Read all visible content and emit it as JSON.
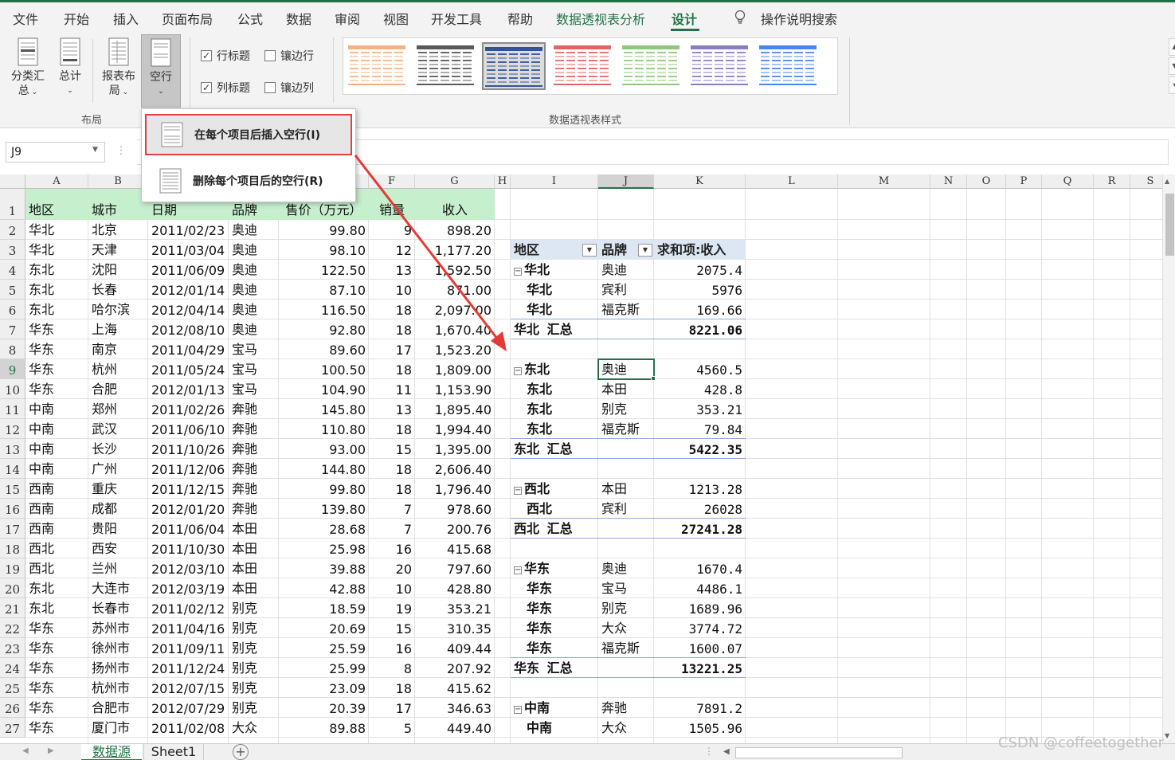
{
  "tabs": [
    "文件",
    "开始",
    "插入",
    "页面布局",
    "公式",
    "数据",
    "审阅",
    "视图",
    "开发工具",
    "帮助",
    "数据透视表分析",
    "设计"
  ],
  "tell_me": "操作说明搜索",
  "ribbon": {
    "subtotals": [
      "分类汇",
      "总"
    ],
    "grand_totals": "总计",
    "report_layout": [
      "报表布",
      "局"
    ],
    "blank_rows": "空行",
    "row_headers": "行标题",
    "banded_rows": "镶边行",
    "col_headers": "列标题",
    "banded_cols": "镶边列",
    "layout_group": "布局",
    "styles_group": "数据透视表样式"
  },
  "checks": {
    "row_headers": true,
    "banded_rows": false,
    "col_headers": true,
    "banded_cols": false
  },
  "style_colors": [
    "#f4b183",
    "#595959",
    "#2f5597",
    "#e06666",
    "#93c47d",
    "#8e7cc3",
    "#4a86e8"
  ],
  "dropdown": {
    "insert": "在每个项目后插入空行(I)",
    "remove": "删除每个项目后的空行(R)"
  },
  "name_box": "J9",
  "columns": [
    "A",
    "B",
    "C",
    "D",
    "E",
    "F",
    "G",
    "H",
    "I",
    "J",
    "K",
    "L",
    "M",
    "N",
    "O",
    "P",
    "Q",
    "R",
    "S"
  ],
  "source_header": [
    "地区",
    "城市",
    "日期",
    "品牌",
    "售价（万元）",
    "销量",
    "收入"
  ],
  "source_rows": [
    [
      "华北",
      "北京",
      "2011/02/23",
      "奥迪",
      "99.80",
      "9",
      "898.20"
    ],
    [
      "华北",
      "天津",
      "2011/03/04",
      "奥迪",
      "98.10",
      "12",
      "1,177.20"
    ],
    [
      "东北",
      "沈阳",
      "2011/06/09",
      "奥迪",
      "122.50",
      "13",
      "1,592.50"
    ],
    [
      "东北",
      "长春",
      "2012/01/14",
      "奥迪",
      "87.10",
      "10",
      "871.00"
    ],
    [
      "东北",
      "哈尔滨",
      "2012/04/14",
      "奥迪",
      "116.50",
      "18",
      "2,097.00"
    ],
    [
      "华东",
      "上海",
      "2012/08/10",
      "奥迪",
      "92.80",
      "18",
      "1,670.40"
    ],
    [
      "华东",
      "南京",
      "2011/04/29",
      "宝马",
      "89.60",
      "17",
      "1,523.20"
    ],
    [
      "华东",
      "杭州",
      "2011/05/24",
      "宝马",
      "100.50",
      "18",
      "1,809.00"
    ],
    [
      "华东",
      "合肥",
      "2012/01/13",
      "宝马",
      "104.90",
      "11",
      "1,153.90"
    ],
    [
      "中南",
      "郑州",
      "2011/02/26",
      "奔驰",
      "145.80",
      "13",
      "1,895.40"
    ],
    [
      "中南",
      "武汉",
      "2011/06/10",
      "奔驰",
      "110.80",
      "18",
      "1,994.40"
    ],
    [
      "中南",
      "长沙",
      "2011/10/26",
      "奔驰",
      "93.00",
      "15",
      "1,395.00"
    ],
    [
      "中南",
      "广州",
      "2011/12/06",
      "奔驰",
      "144.80",
      "18",
      "2,606.40"
    ],
    [
      "西南",
      "重庆",
      "2011/12/15",
      "奔驰",
      "99.80",
      "18",
      "1,796.40"
    ],
    [
      "西南",
      "成都",
      "2012/01/20",
      "奔驰",
      "139.80",
      "7",
      "978.60"
    ],
    [
      "西南",
      "贵阳",
      "2011/06/04",
      "本田",
      "28.68",
      "7",
      "200.76"
    ],
    [
      "西北",
      "西安",
      "2011/10/30",
      "本田",
      "25.98",
      "16",
      "415.68"
    ],
    [
      "西北",
      "兰州",
      "2012/03/10",
      "本田",
      "39.88",
      "20",
      "797.60"
    ],
    [
      "东北",
      "大连市",
      "2012/03/19",
      "本田",
      "42.88",
      "10",
      "428.80"
    ],
    [
      "东北",
      "长春市",
      "2011/02/12",
      "别克",
      "18.59",
      "19",
      "353.21"
    ],
    [
      "华东",
      "苏州市",
      "2011/04/16",
      "别克",
      "20.69",
      "15",
      "310.35"
    ],
    [
      "华东",
      "徐州市",
      "2011/09/11",
      "别克",
      "25.59",
      "16",
      "409.44"
    ],
    [
      "华东",
      "扬州市",
      "2011/12/24",
      "别克",
      "25.99",
      "8",
      "207.92"
    ],
    [
      "华东",
      "杭州市",
      "2012/07/15",
      "别克",
      "23.09",
      "18",
      "415.62"
    ],
    [
      "华东",
      "合肥市",
      "2012/07/29",
      "别克",
      "20.39",
      "17",
      "346.63"
    ],
    [
      "华东",
      "厦门市",
      "2011/02/08",
      "大众",
      "89.88",
      "5",
      "449.40"
    ]
  ],
  "pivot": {
    "headers": [
      "地区",
      "品牌",
      "求和项:收入"
    ],
    "rows": [
      {
        "region": "华北",
        "brand": "奥迪",
        "value": "2075.4",
        "first": true
      },
      {
        "region": "华北",
        "brand": "宾利",
        "value": "5976"
      },
      {
        "region": "华北",
        "brand": "福克斯",
        "value": "169.66"
      },
      {
        "total": "华北 汇总",
        "value": "8221.06"
      },
      {
        "blank": true
      },
      {
        "region": "东北",
        "brand": "奥迪",
        "value": "4560.5",
        "first": true
      },
      {
        "region": "东北",
        "brand": "本田",
        "value": "428.8"
      },
      {
        "region": "东北",
        "brand": "别克",
        "value": "353.21"
      },
      {
        "region": "东北",
        "brand": "福克斯",
        "value": "79.84"
      },
      {
        "total": "东北 汇总",
        "value": "5422.35"
      },
      {
        "blank": true
      },
      {
        "region": "西北",
        "brand": "本田",
        "value": "1213.28",
        "first": true
      },
      {
        "region": "西北",
        "brand": "宾利",
        "value": "26028"
      },
      {
        "total": "西北 汇总",
        "value": "27241.28"
      },
      {
        "blank": true
      },
      {
        "region": "华东",
        "brand": "奥迪",
        "value": "1670.4",
        "first": true
      },
      {
        "region": "华东",
        "brand": "宝马",
        "value": "4486.1"
      },
      {
        "region": "华东",
        "brand": "别克",
        "value": "1689.96"
      },
      {
        "region": "华东",
        "brand": "大众",
        "value": "3774.72"
      },
      {
        "region": "华东",
        "brand": "福克斯",
        "value": "1600.07"
      },
      {
        "total": "华东 汇总",
        "value": "13221.25"
      },
      {
        "blank": true
      },
      {
        "region": "中南",
        "brand": "奔驰",
        "value": "7891.2",
        "first": true
      },
      {
        "region": "中南",
        "brand": "大众",
        "value": "1505.96"
      }
    ]
  },
  "sheets": [
    "数据源",
    "Sheet1"
  ],
  "watermark": "CSDN @coffeetogether"
}
